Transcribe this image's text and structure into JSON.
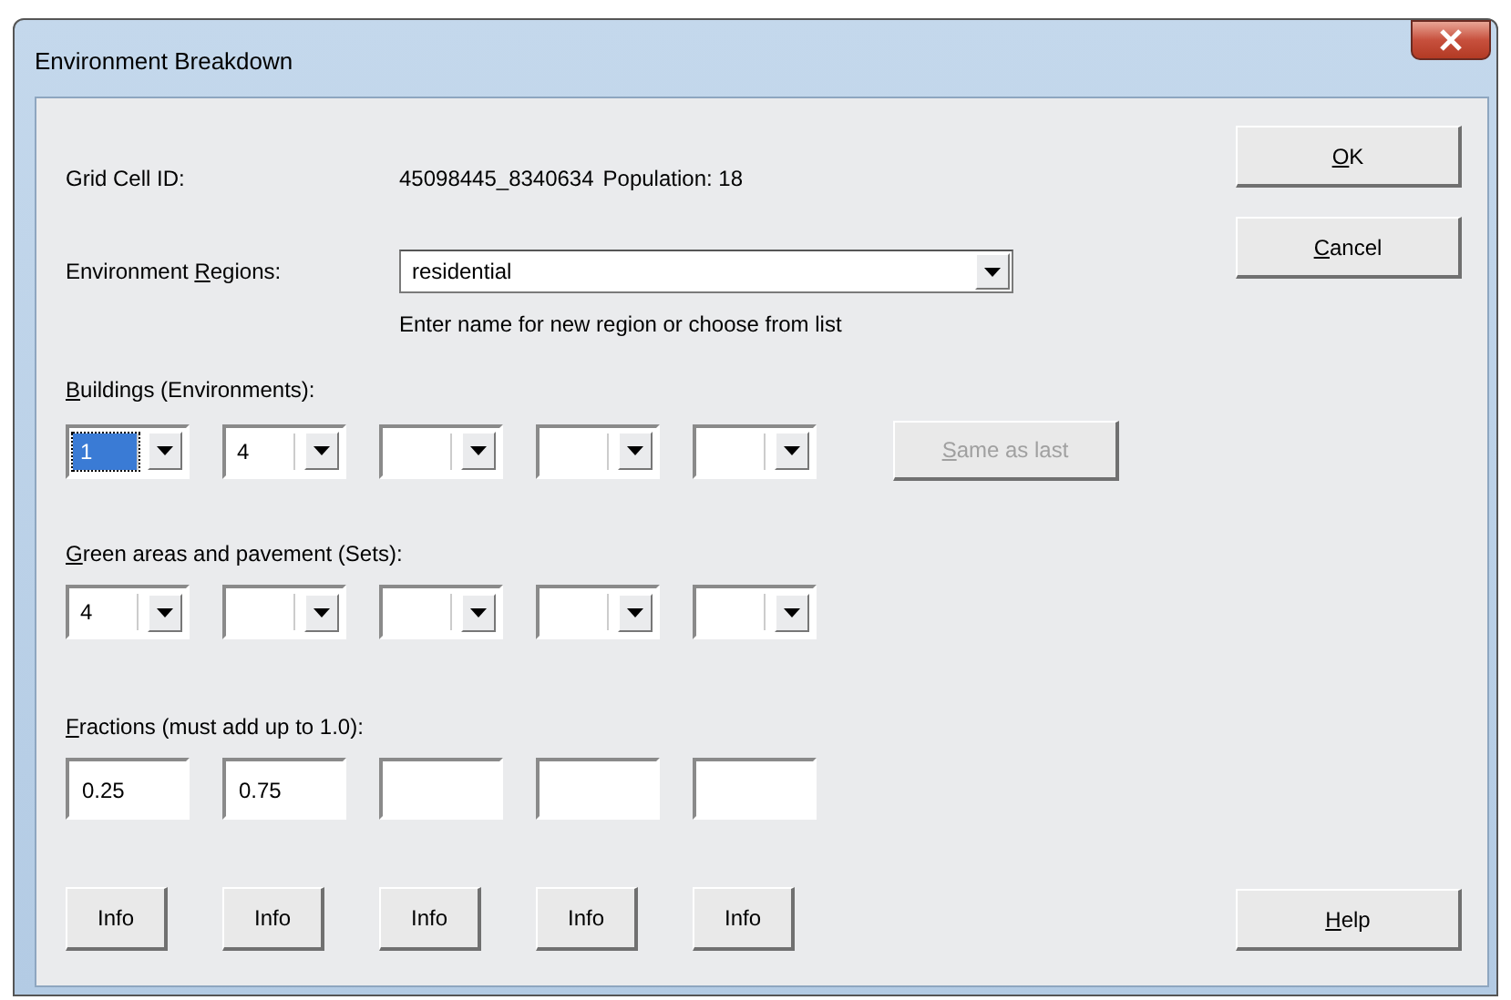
{
  "window": {
    "title": "Environment Breakdown"
  },
  "grid_cell": {
    "label": "Grid Cell ID:",
    "value": "45098445_8340634",
    "population": "Population: 18"
  },
  "regions": {
    "label": {
      "pre": "Environment ",
      "key": "R",
      "post": "egions:"
    },
    "value": "residential",
    "hint": "Enter name for new region or choose from list"
  },
  "buildings": {
    "label": {
      "key": "B",
      "post": "uildings (Environments):"
    },
    "combos": [
      {
        "value": "1",
        "focused": true
      },
      {
        "value": "4",
        "focused": false
      },
      {
        "focused": false
      },
      {
        "focused": false
      },
      {
        "focused": false
      }
    ],
    "same_button": {
      "label": {
        "key": "S",
        "post": "ame as last"
      },
      "disabled": true
    }
  },
  "green": {
    "label": {
      "key": "G",
      "post": "reen areas and pavement (Sets):"
    },
    "combos": [
      {
        "value": "4",
        "focused": false
      },
      {
        "focused": false
      },
      {
        "focused": false
      },
      {
        "focused": false
      },
      {
        "focused": false
      }
    ]
  },
  "fractions": {
    "label": {
      "key": "F",
      "post": "ractions (must add up to 1.0):"
    },
    "fields": [
      "0.25",
      "0.75"
    ]
  },
  "info_buttons": [
    "Info",
    "Info",
    "Info",
    "Info",
    "Info"
  ],
  "buttons": {
    "ok": {
      "key": "O",
      "post": "K"
    },
    "cancel": {
      "key": "C",
      "post": "ancel"
    },
    "help": {
      "key": "H",
      "post": "elp"
    }
  }
}
